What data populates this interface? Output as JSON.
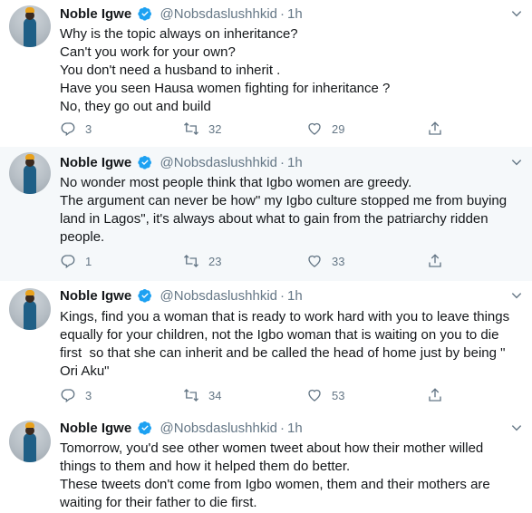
{
  "tweets": [
    {
      "name": "Noble Igwe",
      "handle": "@Nobsdaslushhkid",
      "separator": "·",
      "time": "1h",
      "text": "Why is the topic always on inheritance?\nCan't you work for your own?\nYou don't need a husband to inherit .\nHave you seen Hausa women fighting for inheritance ?\nNo, they go out and build",
      "replies": "3",
      "retweets": "32",
      "likes": "29"
    },
    {
      "name": "Noble Igwe",
      "handle": "@Nobsdaslushhkid",
      "separator": "·",
      "time": "1h",
      "text": "No wonder most people think that Igbo women are greedy.\nThe argument can never be how\" my Igbo culture stopped me from buying land in Lagos\", it's always about what to gain from the patriarchy ridden people.",
      "replies": "1",
      "retweets": "23",
      "likes": "33"
    },
    {
      "name": "Noble Igwe",
      "handle": "@Nobsdaslushhkid",
      "separator": "·",
      "time": "1h",
      "text": "Kings, find you a woman that is ready to work hard with you to leave things equally for your children, not the Igbo woman that is waiting on you to die first  so that she can inherit and be called the head of home just by being \" Ori Aku\"",
      "replies": "3",
      "retweets": "34",
      "likes": "53"
    },
    {
      "name": "Noble Igwe",
      "handle": "@Nobsdaslushhkid",
      "separator": "·",
      "time": "1h",
      "text": "Tomorrow, you'd see other women tweet about how their mother willed things to them and how it helped them do better.\nThese tweets don't come from Igbo women, them and their mothers are waiting for their father to die first.",
      "replies": "",
      "retweets": "",
      "likes": ""
    }
  ],
  "colors": {
    "verified": "#1da1f2",
    "secondary": "#657786",
    "highlight_bg": "#f5f8fa"
  },
  "icons": [
    "reply-icon",
    "retweet-icon",
    "like-icon",
    "share-icon",
    "verified-badge-icon",
    "chevron-down-icon"
  ]
}
